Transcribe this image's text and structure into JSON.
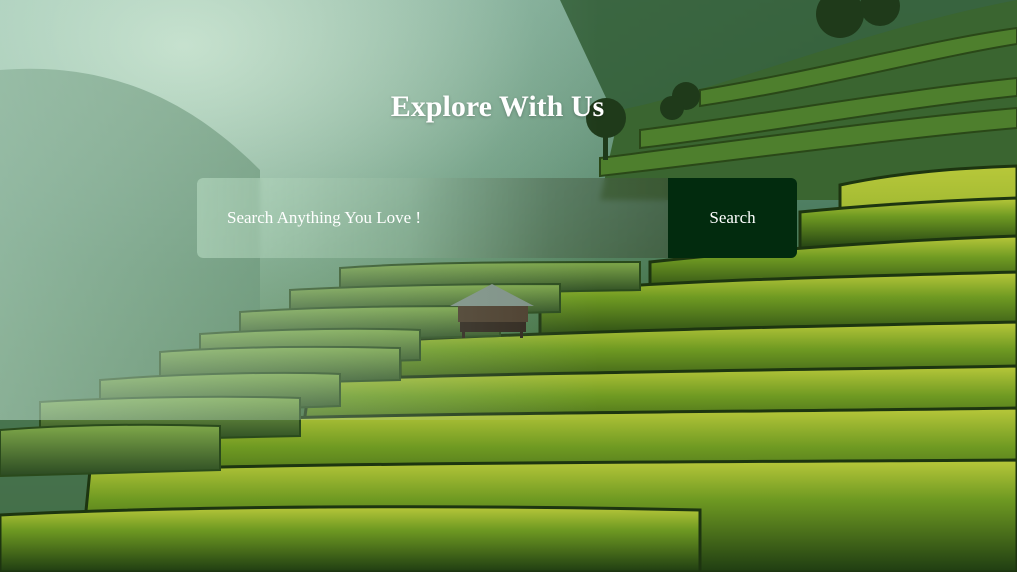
{
  "hero": {
    "title": "Explore With Us",
    "background_image": "rice-terraces-landscape"
  },
  "search": {
    "placeholder": "Search Anything You Love !",
    "value": "",
    "button_label": "Search"
  },
  "colors": {
    "button_background": "#022b0e",
    "text": "#ffffff"
  }
}
